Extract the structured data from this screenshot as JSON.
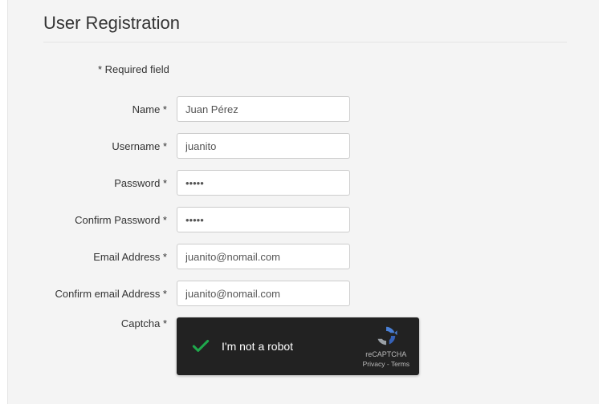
{
  "page": {
    "title": "User Registration",
    "required_note": "* Required field"
  },
  "fields": {
    "name": {
      "label": "Name *",
      "value": "Juan Pérez"
    },
    "username": {
      "label": "Username *",
      "value": "juanito"
    },
    "password": {
      "label": "Password *",
      "value": "•••••"
    },
    "confirm_password": {
      "label": "Confirm Password *",
      "value": "•••••"
    },
    "email": {
      "label": "Email Address *",
      "value": "juanito@nomail.com"
    },
    "confirm_email": {
      "label": "Confirm email Address *",
      "value": "juanito@nomail.com"
    },
    "captcha": {
      "label": "Captcha *"
    }
  },
  "captcha": {
    "text": "I'm not a robot",
    "brand": "reCAPTCHA",
    "links": "Privacy - Terms"
  }
}
